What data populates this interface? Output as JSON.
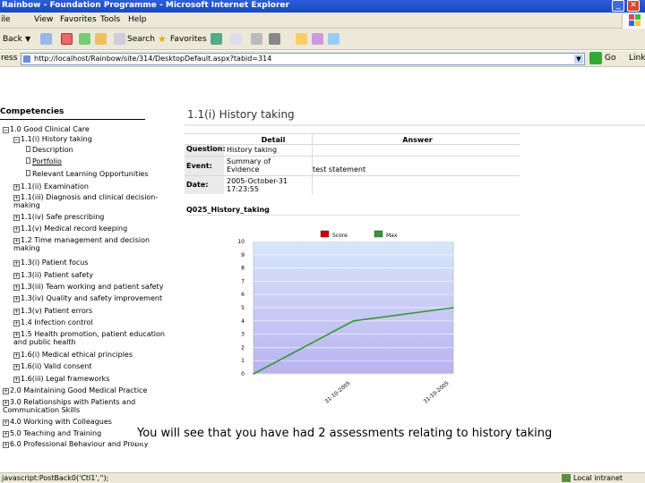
{
  "window": {
    "title": "Rainbow - Foundation Programme - Microsoft Internet Explorer",
    "close_glyph": "✕"
  },
  "menu": [
    "File",
    "View",
    "Favorites",
    "Tools",
    "Help"
  ],
  "menu_first_partial": "ile",
  "toolbar": {
    "back": "Back",
    "search": "Search",
    "favorites": "Favorites"
  },
  "address": {
    "label": "ress",
    "url": "http://localhost/Rainbow/site/314/DesktopDefault.aspx?tabid=314",
    "go": "Go",
    "links": "Links"
  },
  "tree": {
    "heading": "Competencies",
    "items": [
      {
        "label": "1.0 Good Clinical Care",
        "exp": "⊟"
      },
      {
        "label": "1.1(i) History taking",
        "exp": "⊟"
      },
      {
        "label": "Description"
      },
      {
        "label": "Portfolio"
      },
      {
        "label": "Relevant Learning Opportunities"
      },
      {
        "label": "1.1(ii) Examination",
        "exp": "⊞"
      },
      {
        "label": "1.1(iii) Diagnosis and clinical decision-making",
        "exp": "⊞"
      },
      {
        "label": "1.1(iv) Safe prescribing",
        "exp": "⊞"
      },
      {
        "label": "1.1(v) Medical record keeping",
        "exp": "⊞"
      },
      {
        "label": "1.2 Time management and decision making",
        "exp": "⊞"
      },
      {
        "label": "1.3(i) Patient focus",
        "exp": "⊞"
      },
      {
        "label": "1.3(ii) Patient safety",
        "exp": "⊞"
      },
      {
        "label": "1.3(iii) Team working and patient safety",
        "exp": "⊞"
      },
      {
        "label": "1.3(iv) Quality and safety improvement",
        "exp": "⊞"
      },
      {
        "label": "1.3(v) Patient errors",
        "exp": "⊞"
      },
      {
        "label": "1.4 Infection control",
        "exp": "⊞"
      },
      {
        "label": "1.5 Health promotion, patient education and public health",
        "exp": "⊞"
      },
      {
        "label": "1.6(i) Medical ethical principles",
        "exp": "⊞"
      },
      {
        "label": "1.6(ii) Valid consent",
        "exp": "⊞"
      },
      {
        "label": "1.6(iii) Legal frameworks",
        "exp": "⊞"
      },
      {
        "label": "2.0 Maintaining Good Medical Practice",
        "exp": "⊞"
      },
      {
        "label": "3.0 Relationships with Patients and Communication Skills",
        "exp": "⊞"
      },
      {
        "label": "4.0 Working with Colleagues",
        "exp": "⊞"
      },
      {
        "label": "5.0 Teaching and Training",
        "exp": "⊞"
      },
      {
        "label": "6.0 Professional Behaviour and Probity",
        "exp": "⊞"
      }
    ]
  },
  "page": {
    "title": "1.1(i) History taking"
  },
  "details": {
    "col_detail": "Detail",
    "col_answer": "Answer",
    "rows": [
      {
        "label": "Question:",
        "detail": "History taking",
        "answer": ""
      },
      {
        "label": "Event:",
        "detail": "Summary of Evidence",
        "answer": "test statement"
      },
      {
        "label": "Date:",
        "detail": "2005-October-31 17:23:55",
        "answer": ""
      }
    ]
  },
  "question_id": "Q025_History_taking",
  "chart_data": {
    "type": "line",
    "x": [
      "31-10-2005",
      "31-10-2005"
    ],
    "series": [
      {
        "name": "Score",
        "color": "#cc0000",
        "values": []
      },
      {
        "name": "Max",
        "color": "#339933",
        "values": [
          0,
          4,
          5
        ]
      }
    ],
    "ylim": [
      0,
      10
    ],
    "yticks": [
      "0",
      "1",
      "2",
      "3",
      "4",
      "5",
      "6",
      "7",
      "8",
      "9",
      "10"
    ],
    "legend": "top",
    "grid": true,
    "plot_background": "#c6d8f7"
  },
  "caption": "You will see that you have had 2 assessments relating to history taking",
  "status": {
    "left": "javascript:PostBack0('Ctl1','');",
    "zone": "Local intranet"
  }
}
